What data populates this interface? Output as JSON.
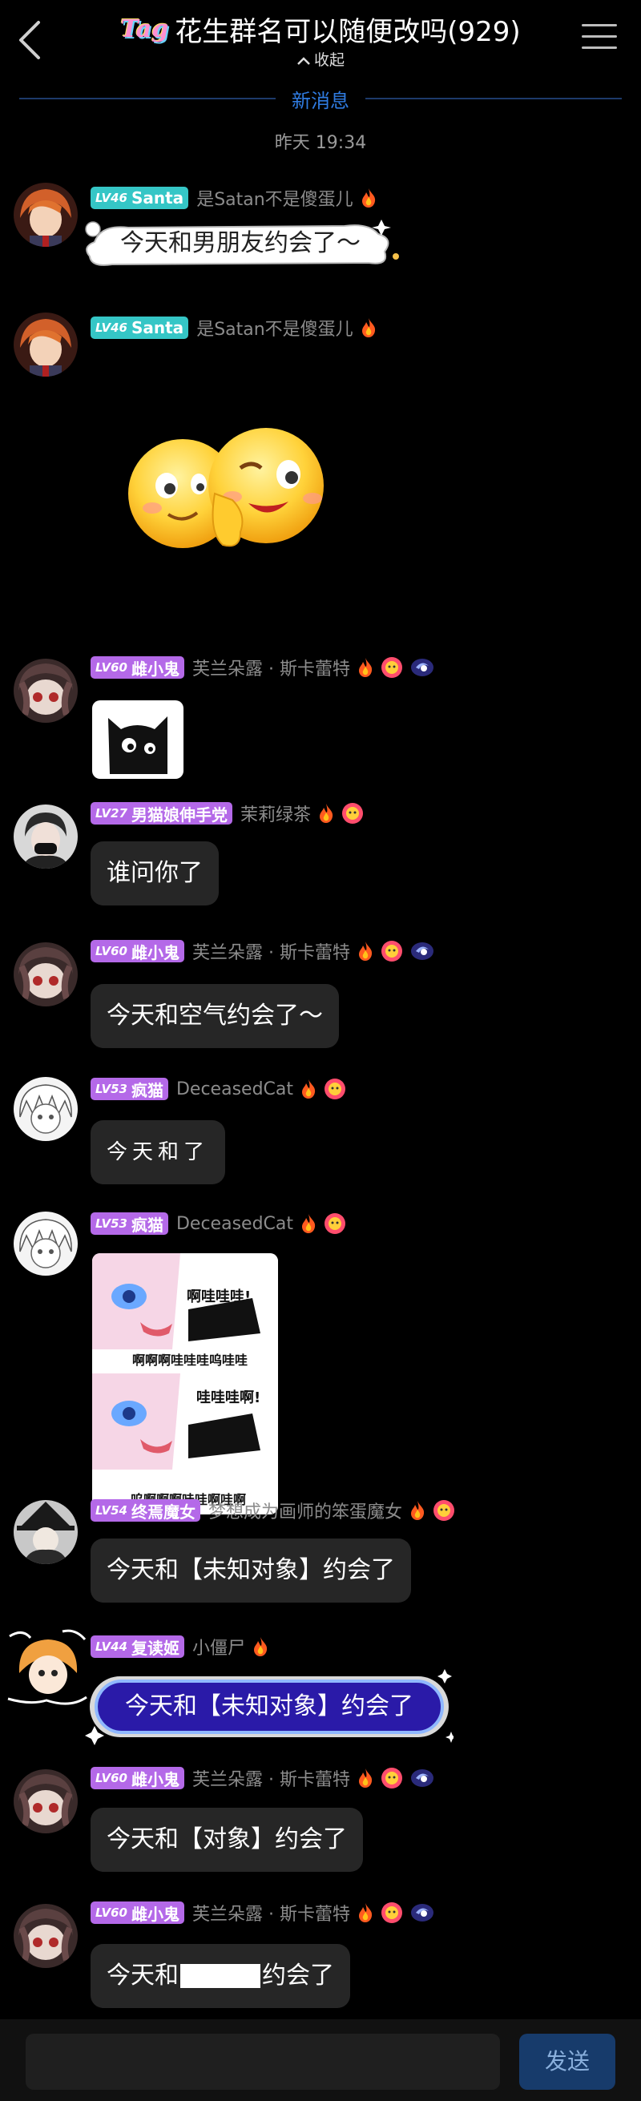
{
  "header": {
    "tag_text": "Tag",
    "title": "花生群名可以随便改吗(929)",
    "collapse_label": "收起"
  },
  "divider": {
    "new_messages": "新消息",
    "time": "昨天 19:34"
  },
  "messages": [
    {
      "level": "LV46",
      "badge": "Santa",
      "name": "是Satan不是傻蛋儿",
      "text": "今天和男朋友约会了～"
    },
    {
      "level": "LV46",
      "badge": "Santa",
      "name": "是Satan不是傻蛋儿",
      "sticker": "emoji-pair-sticker"
    },
    {
      "level": "LV60",
      "badge": "雌小鬼",
      "name": "芙兰朵露 · 斯卡蕾特",
      "sticker": "black-cat-sticker"
    },
    {
      "level": "LV27",
      "badge": "男猫娘伸手党",
      "name": "茉莉绿茶",
      "text": "谁问你了"
    },
    {
      "level": "LV60",
      "badge": "雌小鬼",
      "name": "芙兰朵露 · 斯卡蕾特",
      "text": "今天和空气约会了～"
    },
    {
      "level": "LV53",
      "badge": "疯猫",
      "name": "DeceasedCat",
      "text": "今天和了"
    },
    {
      "level": "LV53",
      "badge": "疯猫",
      "name": "DeceasedCat",
      "meme_lines": [
        "啊哇哇哇!",
        "啊啊啊哇哇哇呜哇哇",
        "哇哇哇啊!",
        "呜啊啊啊哇哇啊哇啊"
      ]
    },
    {
      "level": "LV54",
      "badge": "终焉魔女",
      "name": "梦想成为画师的笨蛋魔女",
      "text": "今天和【未知对象】约会了"
    },
    {
      "level": "LV44",
      "badge": "复读姬",
      "name": "小僵尸",
      "text": "今天和【未知对象】约会了"
    },
    {
      "level": "LV60",
      "badge": "雌小鬼",
      "name": "芙兰朵露 · 斯卡蕾特",
      "text": "今天和【对象】约会了"
    },
    {
      "level": "LV60",
      "badge": "雌小鬼",
      "name": "芙兰朵露 · 斯卡蕾特",
      "text_before": "今天和",
      "text_after": "约会了"
    }
  ],
  "input": {
    "send_label": "发送"
  },
  "colors": {
    "background": "#000000",
    "bubble": "#262626",
    "teal_badge": "#35c6c6",
    "purple_badge": "#b469e8",
    "accent": "#2f7be0"
  }
}
